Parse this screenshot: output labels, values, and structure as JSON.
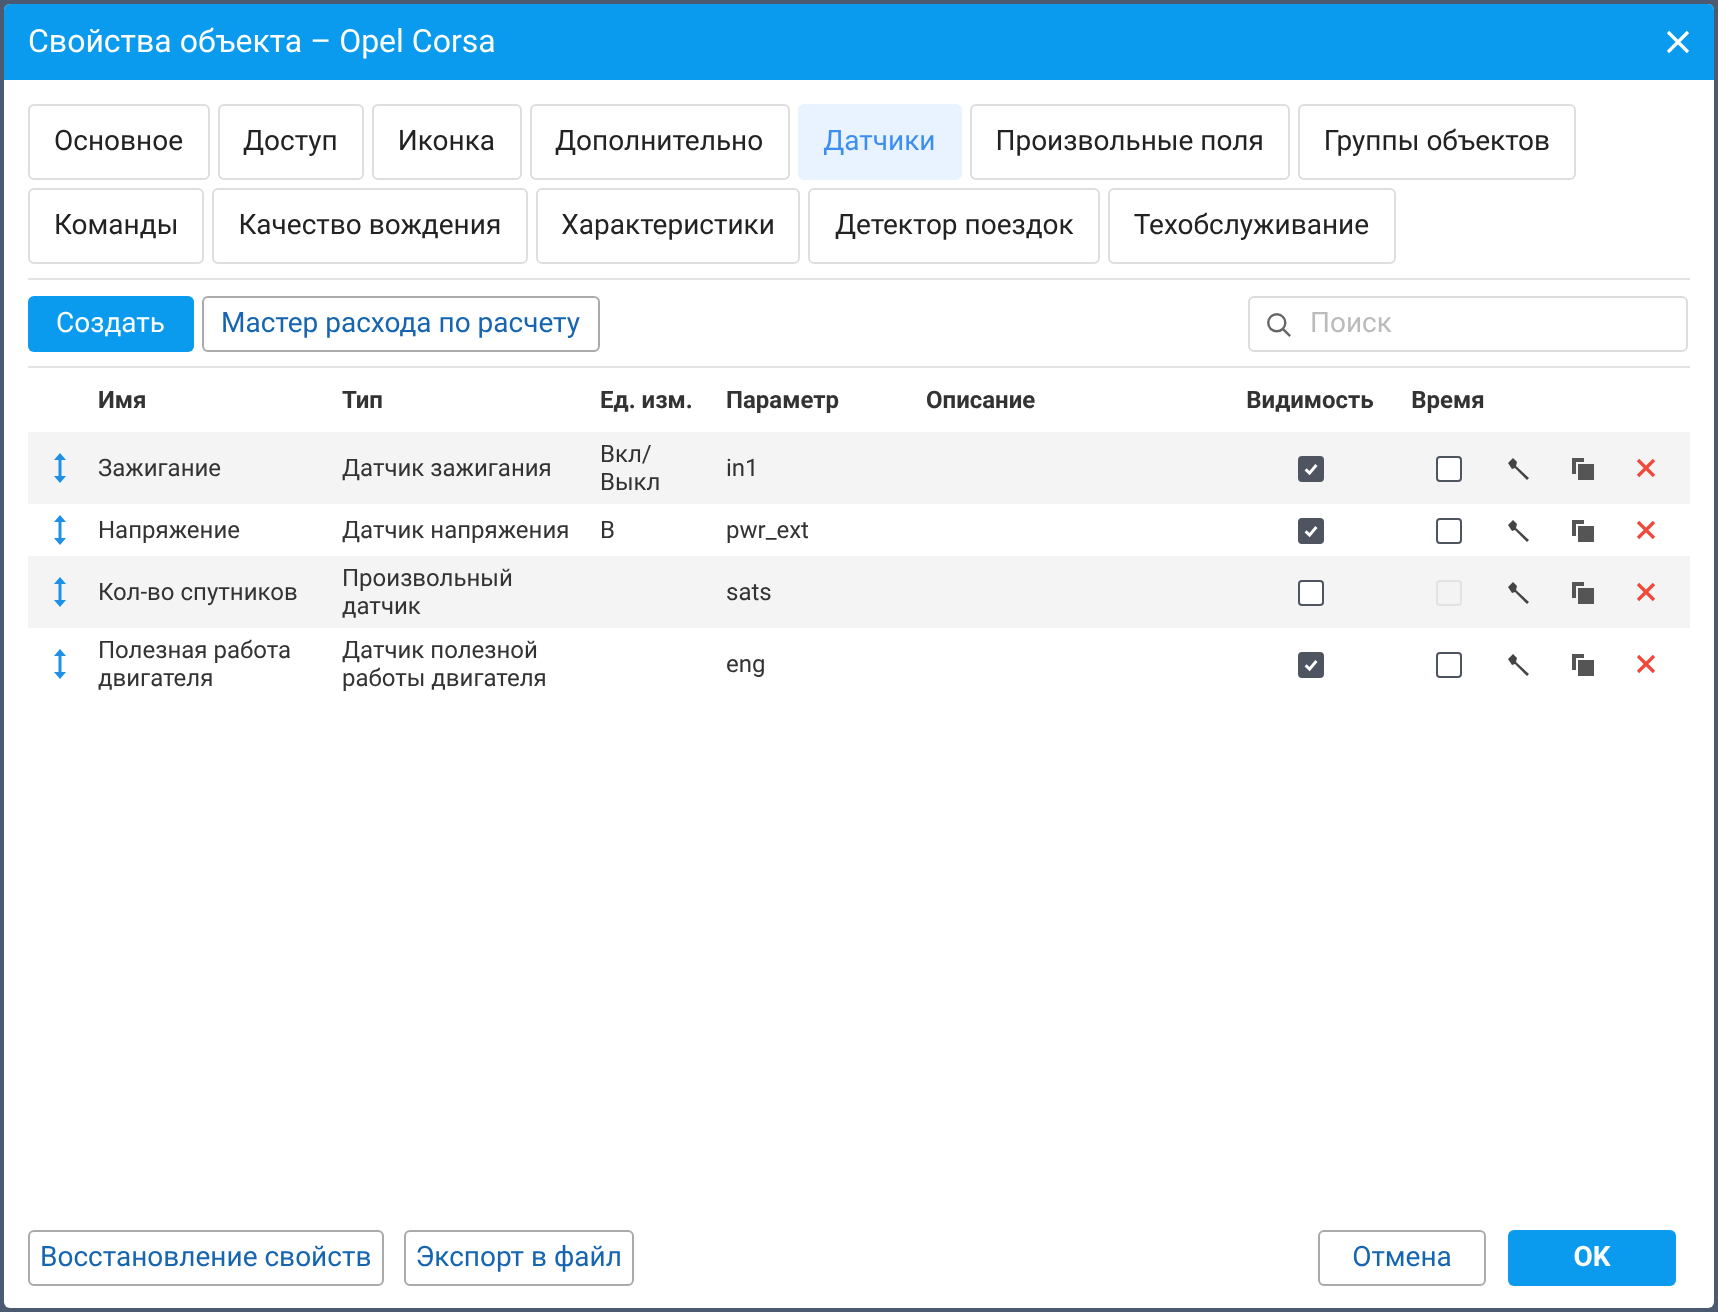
{
  "window": {
    "title": "Свойства объекта – Opel Corsa"
  },
  "tabs": [
    {
      "label": "Основное",
      "selected": false
    },
    {
      "label": "Доступ",
      "selected": false
    },
    {
      "label": "Иконка",
      "selected": false
    },
    {
      "label": "Дополнительно",
      "selected": false
    },
    {
      "label": "Датчики",
      "selected": true
    },
    {
      "label": "Произвольные поля",
      "selected": false
    },
    {
      "label": "Группы объектов",
      "selected": false
    },
    {
      "label": "Команды",
      "selected": false
    },
    {
      "label": "Качество вождения",
      "selected": false
    },
    {
      "label": "Характеристики",
      "selected": false
    },
    {
      "label": "Детектор поездок",
      "selected": false
    },
    {
      "label": "Техобслуживание",
      "selected": false
    }
  ],
  "toolbar": {
    "create_button": "Создать",
    "wizard_button": "Мастер расхода по расчету",
    "search": {
      "placeholder": "Поиск"
    }
  },
  "table": {
    "columns": [
      "Имя",
      "Тип",
      "Ед. изм.",
      "Параметр",
      "Описание",
      "Видимость",
      "Время"
    ],
    "rows": [
      {
        "name": "Зажигание",
        "type": "Датчик зажигания",
        "unit": "Вкл/ Выкл",
        "parameter": "in1",
        "visible": true,
        "time": {
          "checked": false,
          "disabled": false
        }
      },
      {
        "name": "Напряжение",
        "type": "Датчик напряжения",
        "unit": "В",
        "parameter": "pwr_ext",
        "visible": true,
        "time": {
          "checked": false,
          "disabled": false
        }
      },
      {
        "name": "Кол-во спутников",
        "type": "Произвольный датчик",
        "unit": "",
        "parameter": "sats",
        "visible": false,
        "time": {
          "checked": false,
          "disabled": true
        }
      },
      {
        "name": "Полезная работа двигателя",
        "type": "Датчик полезной работы двигателя",
        "unit": "",
        "parameter": "eng",
        "visible": true,
        "time": {
          "checked": false,
          "disabled": false
        }
      }
    ]
  },
  "footer": {
    "left_buttons": [
      "Восстановление свойств",
      "Экспорт в файл"
    ],
    "cancel_button": "Отмена",
    "ok_button": "OK"
  }
}
